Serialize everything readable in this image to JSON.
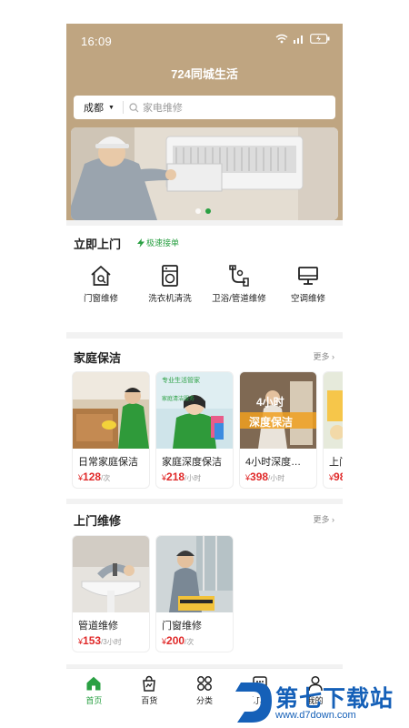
{
  "status": {
    "time": "16:09"
  },
  "app": {
    "title": "724同城生活"
  },
  "search": {
    "city": "成都",
    "placeholder": "家电维修"
  },
  "door_service": {
    "title": "立即上门",
    "badge": "极速接单",
    "items": [
      {
        "label": "门窗维修",
        "icon": "house-icon"
      },
      {
        "label": "洗衣机清洗",
        "icon": "washing-machine-icon"
      },
      {
        "label": "卫浴/管道维修",
        "icon": "pipe-icon"
      },
      {
        "label": "空调维修",
        "icon": "monitor-icon"
      }
    ]
  },
  "home_cleaning": {
    "title": "家庭保洁",
    "more": "更多",
    "products": [
      {
        "name": "日常家庭保洁",
        "price": "128",
        "unit": "/次"
      },
      {
        "name": "家庭深度保洁",
        "price": "218",
        "unit": "/小时"
      },
      {
        "name": "4小时深度…",
        "price": "398",
        "unit": "/小时"
      },
      {
        "name": "上门…",
        "price": "98",
        "unit": ""
      }
    ],
    "image_texts": {
      "p2_banner": "专业生活管家",
      "p2_sub": "家庭清洁服务",
      "p3_top": "4小时",
      "p3_bottom": "深度保洁"
    }
  },
  "repair": {
    "title": "上门维修",
    "more": "更多",
    "products": [
      {
        "name": "管道维修",
        "price": "153",
        "unit": "/3小时"
      },
      {
        "name": "门窗维修",
        "price": "200",
        "unit": "/次"
      }
    ]
  },
  "tabbar": {
    "items": [
      {
        "label": "首页",
        "active": true
      },
      {
        "label": "百货"
      },
      {
        "label": "分类"
      },
      {
        "label": "订单"
      },
      {
        "label": "我的"
      }
    ]
  },
  "watermark": {
    "title": "第七下载站",
    "url": "www.d7down.com"
  },
  "colors": {
    "accent": "#2aa043",
    "hero": "#bfa581",
    "price": "#e02a2a"
  }
}
